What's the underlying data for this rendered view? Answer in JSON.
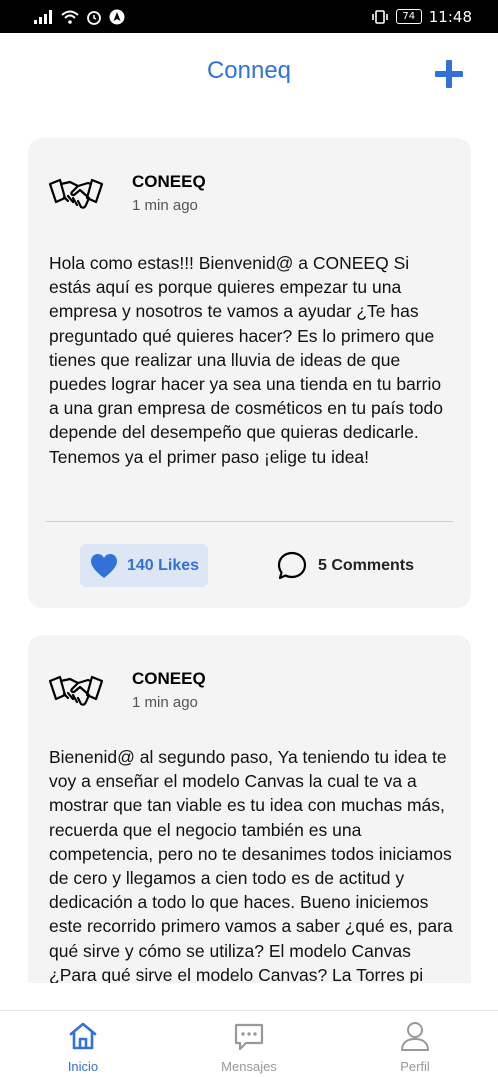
{
  "status_bar": {
    "time": "11:48",
    "battery": "74"
  },
  "header": {
    "title": "Conneq",
    "add_icon": "plus-icon"
  },
  "posts": [
    {
      "author": "CONEEQ",
      "time": "1 min ago",
      "avatar_icon": "handshake-icon",
      "text": "Hola como estas!!! Bienvenid@ a CONEEQ Si estás aquí es porque quieres empezar tu una empresa y nosotros te vamos a ayudar ¿Te has preguntado qué quieres hacer? Es lo primero que tienes que realizar una lluvia de ideas de que puedes lograr hacer ya sea una tienda en tu barrio a una gran empresa de cosméticos en tu país todo depende del desempeño que quieras dedicarle. Tenemos ya el primer paso ¡elige tu idea!",
      "likes_label": "140 Likes",
      "comments_label": "5 Comments"
    },
    {
      "author": "CONEEQ",
      "time": "1 min ago",
      "avatar_icon": "handshake-icon",
      "text": "Bienenid@ al segundo paso, Ya teniendo tu idea te voy a enseñar el modelo Canvas la cual te va a mostrar que tan viable es tu idea con muchas más, recuerda que el negocio también es una competencia, pero no te desanimes todos iniciamos de cero y llegamos a cien todo es de actitud y dedicación a todo lo que haces. Bueno iniciemos este recorrido primero vamos a saber ¿qué es, para qué sirve y cómo se utiliza? El modelo Canvas ¿Para qué sirve el modelo Canvas? La Torres pi"
    }
  ],
  "bottom_nav": [
    {
      "label": "Inicio",
      "icon": "home-icon",
      "active": true
    },
    {
      "label": "Mensajes",
      "icon": "chat-icon",
      "active": false
    },
    {
      "label": "Perfil",
      "icon": "user-icon",
      "active": false
    }
  ],
  "colors": {
    "accent": "#3271d8",
    "card": "#f4f4f4",
    "like_bg": "#dde6f5"
  }
}
